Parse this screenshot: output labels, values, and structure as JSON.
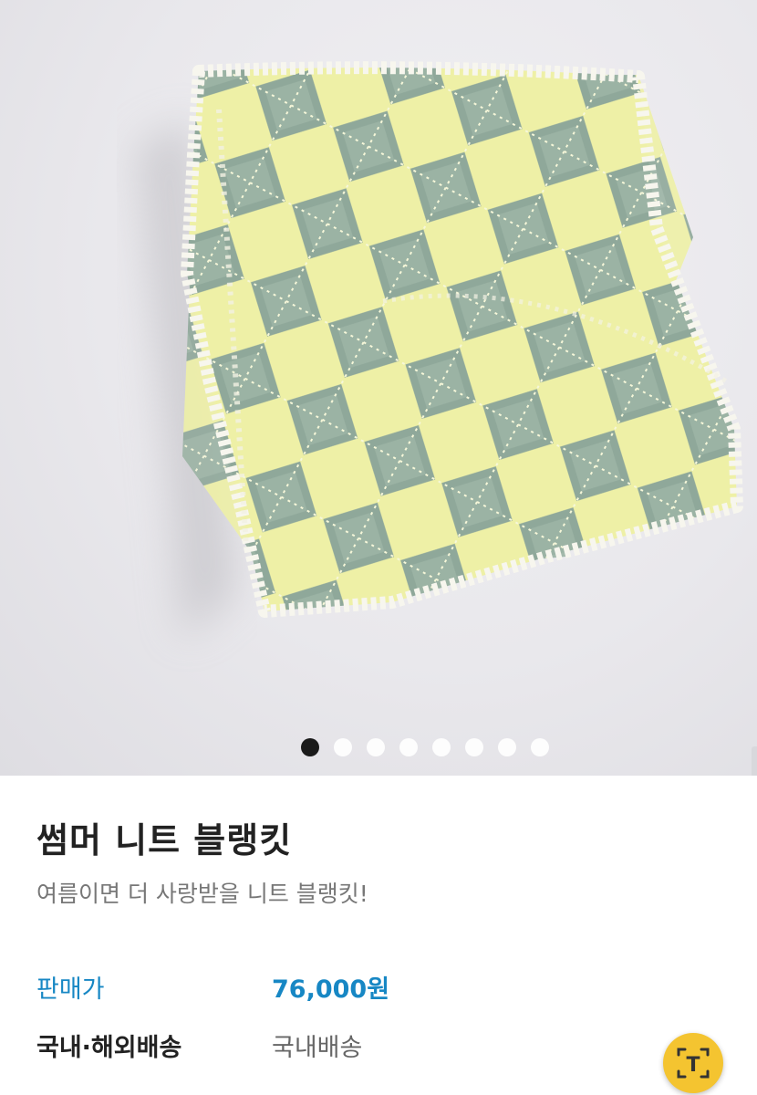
{
  "gallery": {
    "image_alt": "yellow and grey-green argyle knit blanket hanging",
    "dot_count": 8,
    "active_index": 0
  },
  "product": {
    "title": "썸머 니트 블랭킷",
    "subtitle": "여름이면 더 사랑받을 니트 블랭킷!",
    "price_label": "판매가",
    "price_value": "76,000원",
    "shipping_label": "국내·해외배송",
    "shipping_value": "국내배송"
  },
  "floating_button": {
    "icon": "camera-text-icon",
    "letter": "T"
  },
  "colors": {
    "accent_blue": "#1787c4",
    "fab_yellow": "#f4c430",
    "knit_yellow": "#eef0a6",
    "knit_green": "#8fa89a"
  }
}
